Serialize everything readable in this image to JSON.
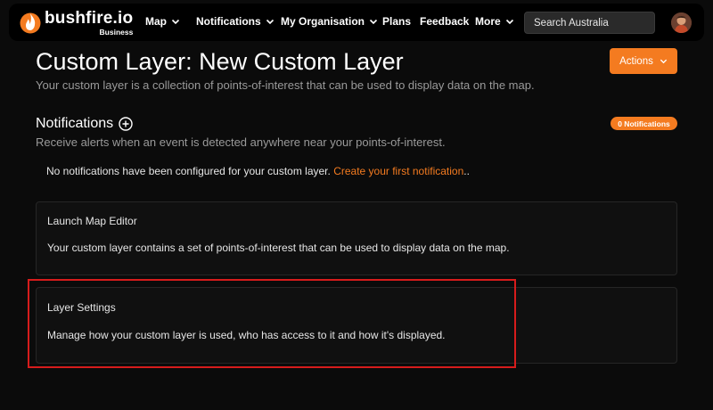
{
  "brand": {
    "name": "bushfire.io",
    "tier": "Business",
    "accent": "#f47b20"
  },
  "nav": {
    "items": [
      {
        "label": "Map",
        "dropdown": true
      },
      {
        "label": "Notifications",
        "dropdown": true
      },
      {
        "label": "My Organisation",
        "dropdown": true
      },
      {
        "label": "Plans",
        "dropdown": false
      },
      {
        "label": "Feedback",
        "dropdown": false
      },
      {
        "label": "More",
        "dropdown": true
      }
    ],
    "search": {
      "placeholder": "Search Australia",
      "value": ""
    }
  },
  "header": {
    "title": "Custom Layer: New Custom Layer",
    "subtitle": "Your custom layer is a collection of points-of-interest that can be used to display data on the map.",
    "actions_label": "Actions"
  },
  "notifications": {
    "heading": "Notifications",
    "badge": "0 Notifications",
    "description": "Receive alerts when an event is detected anywhere near your points-of-interest.",
    "empty_text": "No notifications have been configured for your custom layer. ",
    "empty_link": "Create your first notification",
    "empty_suffix": ".."
  },
  "cards": {
    "map_editor": {
      "title": "Launch Map Editor",
      "text": "Your custom layer contains a set of points-of-interest that can be used to display data on the map."
    },
    "layer_settings": {
      "title": "Layer Settings",
      "text": "Manage how your custom layer is used, who has access to it and how it's displayed."
    }
  },
  "highlight_color": "#d61c1c"
}
